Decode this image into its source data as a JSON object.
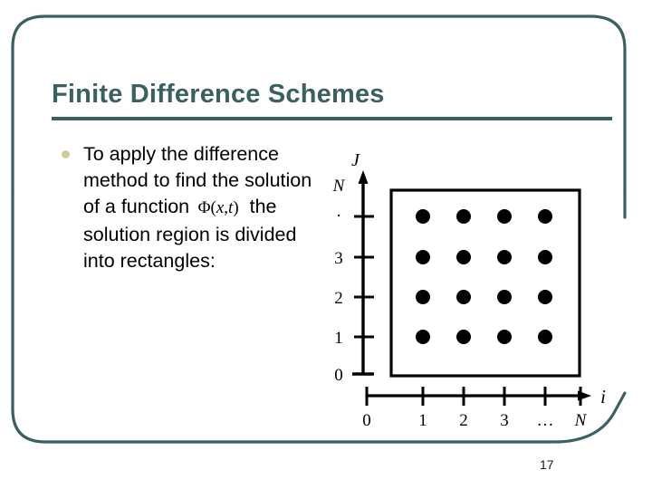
{
  "slide": {
    "title": "Finite Difference Schemes",
    "page_number": "17",
    "accent_color": "#3a6060",
    "bullet_color": "#cfcb9a",
    "background_color": "#ffffff"
  },
  "body": {
    "bullet_marker": "bullet-disc",
    "text_before_formula": "To apply the difference method to find the solution of a function",
    "formula": {
      "symbol": "Φ",
      "open_paren": "(",
      "var_x": "x",
      "comma": ",",
      "var_t": "t",
      "close_paren": ")",
      "plain": "Φ(x,t)"
    },
    "text_after_formula": "the solution region is divided into rectangles:"
  },
  "chart_data": {
    "type": "scatter",
    "title": "",
    "xlabel": "i",
    "ylabel": "J",
    "grid": false,
    "legend": null,
    "x_tick_labels": [
      "0",
      "1",
      "2",
      "3",
      "…",
      "N"
    ],
    "y_tick_labels": [
      "0",
      "1",
      "2",
      "3",
      "·",
      "N"
    ],
    "x_axis_arrow": true,
    "y_axis_arrow": true,
    "region_box": {
      "label": "solution region rectangle",
      "x_from": "0",
      "x_to": "N",
      "y_from": "0",
      "y_to": "N",
      "stroke": "#000000"
    },
    "node_columns": [
      "1",
      "2",
      "3",
      "…"
    ],
    "node_rows": [
      "1",
      "2",
      "3",
      "·"
    ],
    "points": [
      {
        "i": "1",
        "j": "1"
      },
      {
        "i": "2",
        "j": "1"
      },
      {
        "i": "3",
        "j": "1"
      },
      {
        "i": "…",
        "j": "1"
      },
      {
        "i": "1",
        "j": "2"
      },
      {
        "i": "2",
        "j": "2"
      },
      {
        "i": "3",
        "j": "2"
      },
      {
        "i": "…",
        "j": "2"
      },
      {
        "i": "1",
        "j": "3"
      },
      {
        "i": "2",
        "j": "3"
      },
      {
        "i": "3",
        "j": "3"
      },
      {
        "i": "…",
        "j": "3"
      },
      {
        "i": "1",
        "j": "·"
      },
      {
        "i": "2",
        "j": "·"
      },
      {
        "i": "3",
        "j": "·"
      },
      {
        "i": "…",
        "j": "·"
      }
    ],
    "marker": "filled-circle",
    "marker_color": "#000000"
  }
}
